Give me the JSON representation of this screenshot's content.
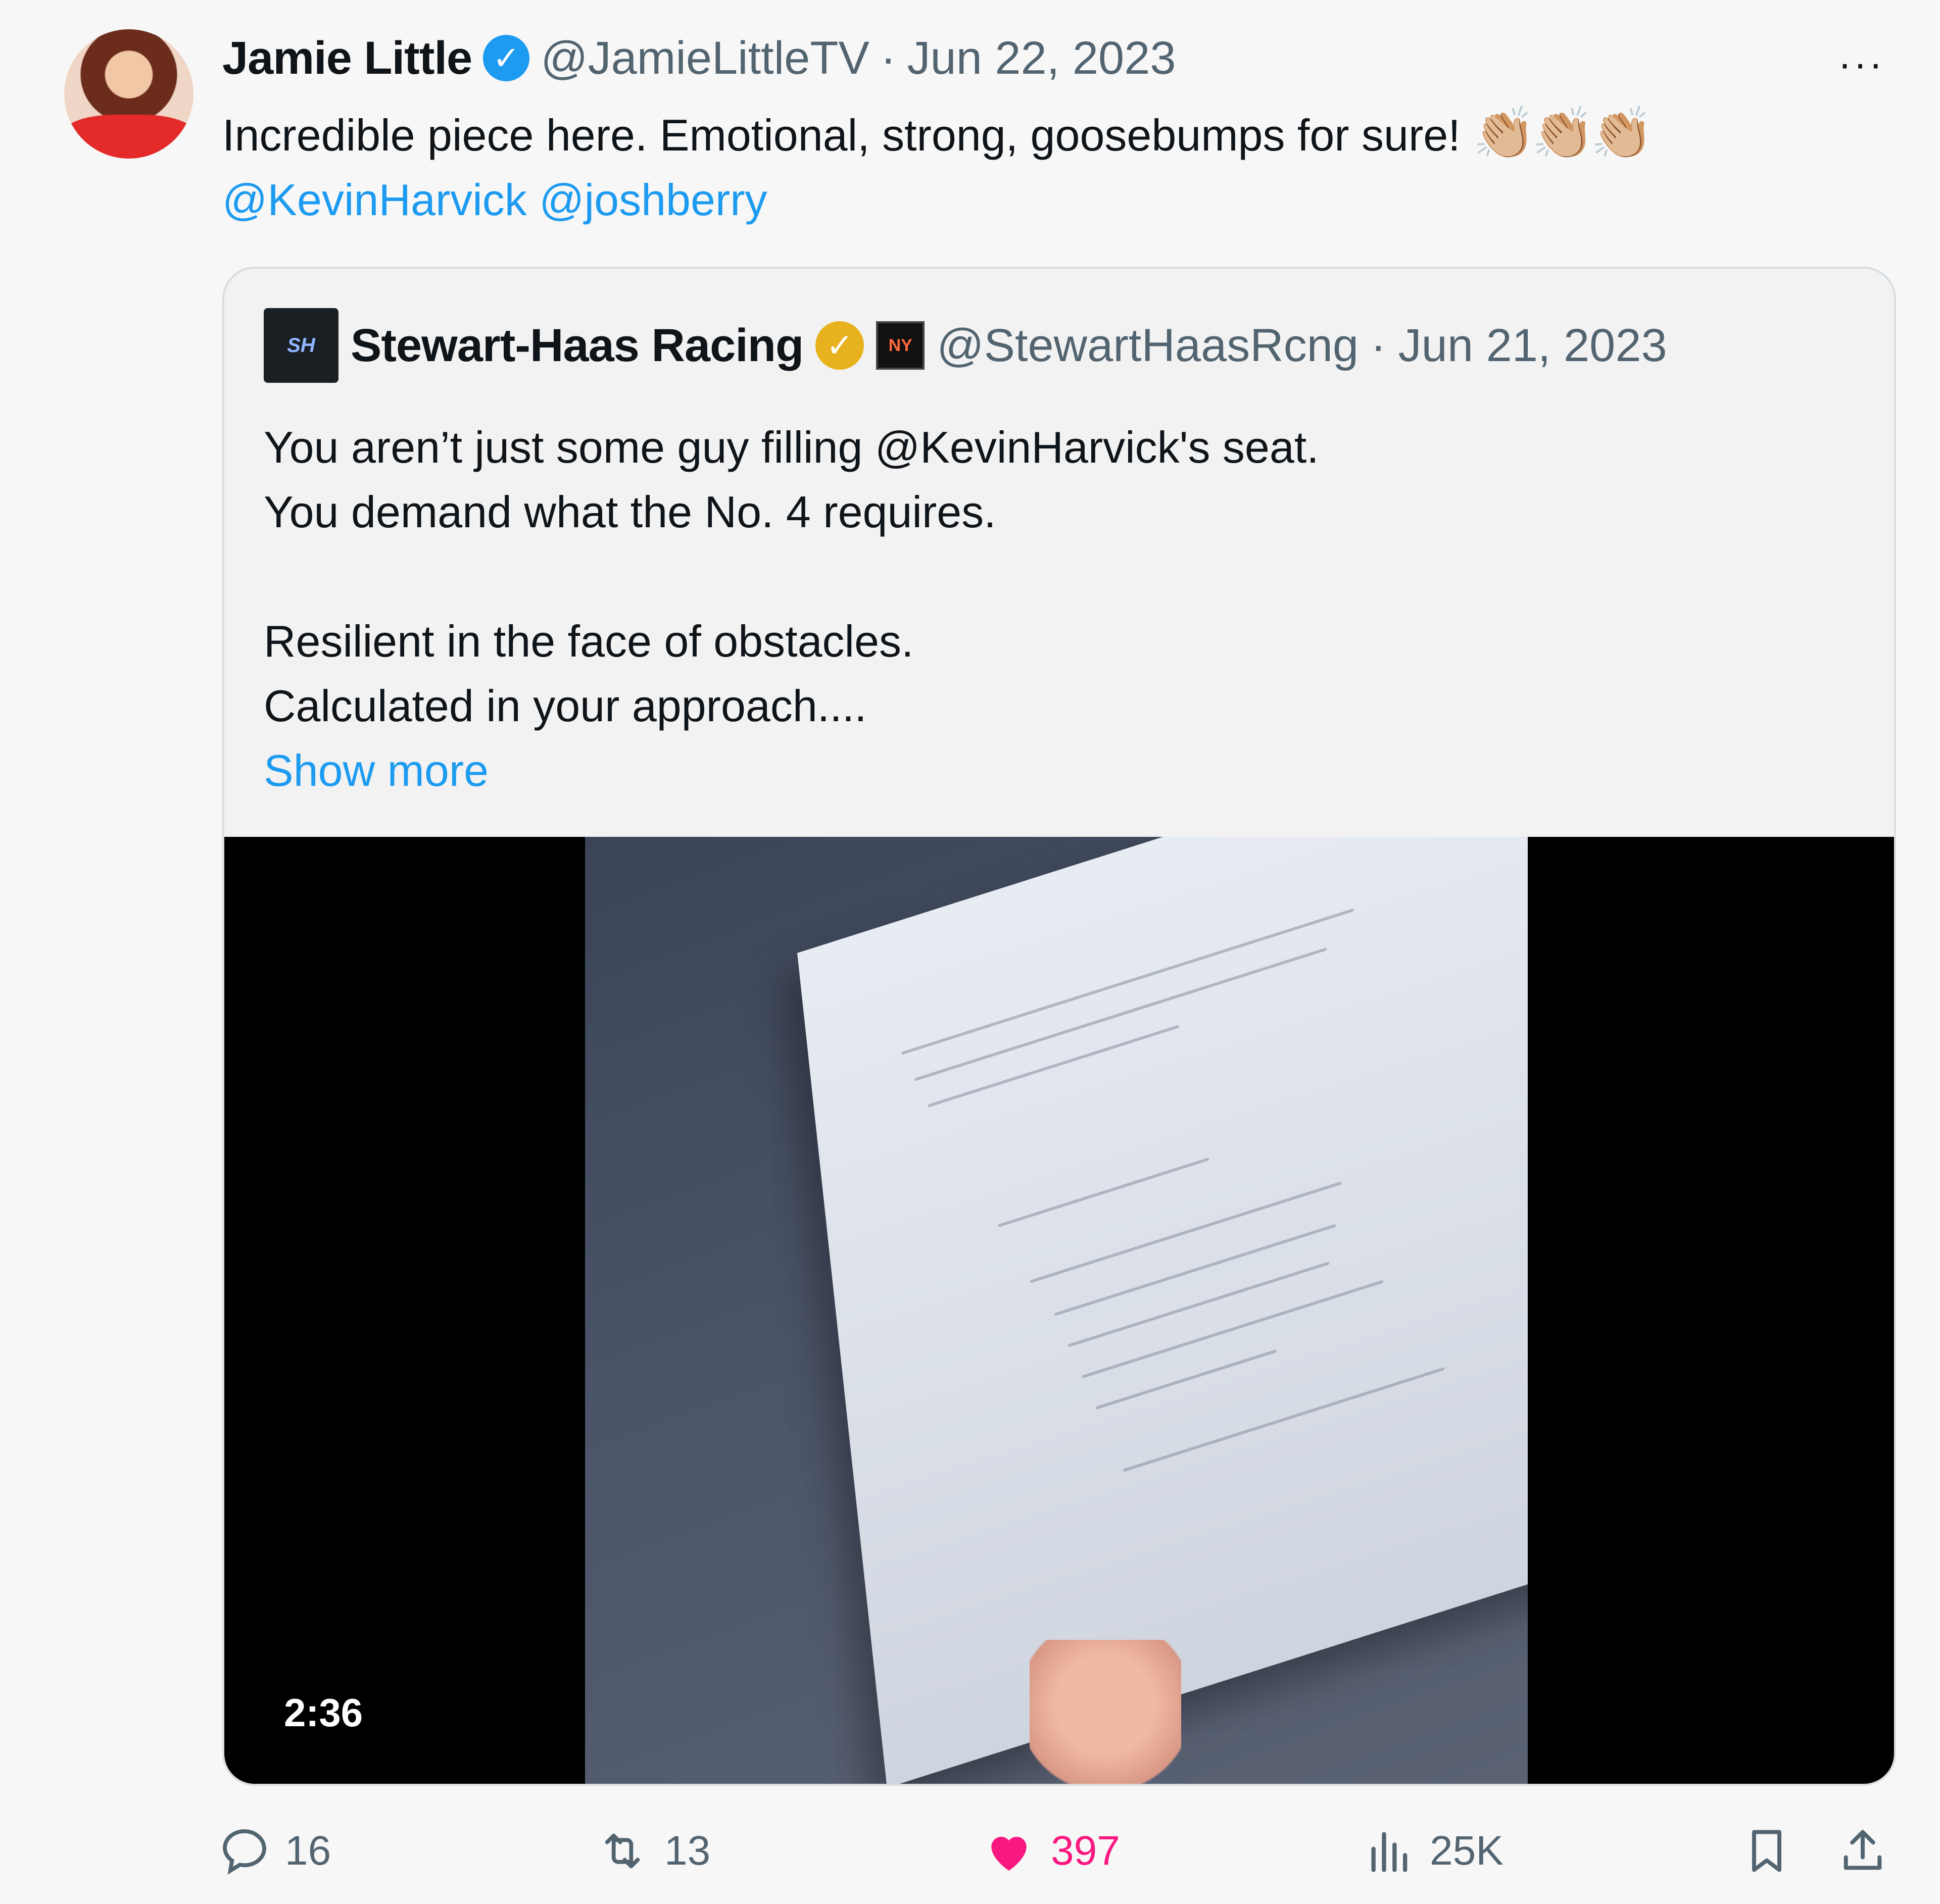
{
  "tweet": {
    "author_name": "Jamie Little",
    "author_handle": "@JamieLittleTV",
    "separator": "·",
    "date": "Jun 22, 2023",
    "more_label": "···",
    "text_main": "Incredible piece here. Emotional, strong, goosebumps for sure!",
    "emoji": "👏🏼👏🏼👏🏼",
    "mention_1": "@KevinHarvick",
    "mention_2": "@joshberry"
  },
  "quote": {
    "author_name": "Stewart-Haas Racing",
    "author_handle": "@StewartHaasRcng",
    "separator": "·",
    "date": "Jun 21, 2023",
    "line_1": "You aren’t just some guy filling @KevinHarvick's seat.",
    "line_2": "You demand what the No. 4 requires.",
    "line_3": "Resilient in the face of obstacles.",
    "line_4": "Calculated in your approach....",
    "show_more": "Show more",
    "video_duration": "2:36"
  },
  "actions": {
    "replies": "16",
    "retweets": "13",
    "likes": "397",
    "views": "25K"
  },
  "colors": {
    "accent": "#1d9bf0",
    "like": "#f91880",
    "verified_gold": "#e8b21e"
  },
  "icons": {
    "reply": "reply-icon",
    "retweet": "retweet-icon",
    "like": "heart-icon",
    "views": "views-icon",
    "bookmark": "bookmark-icon",
    "share": "share-icon"
  }
}
